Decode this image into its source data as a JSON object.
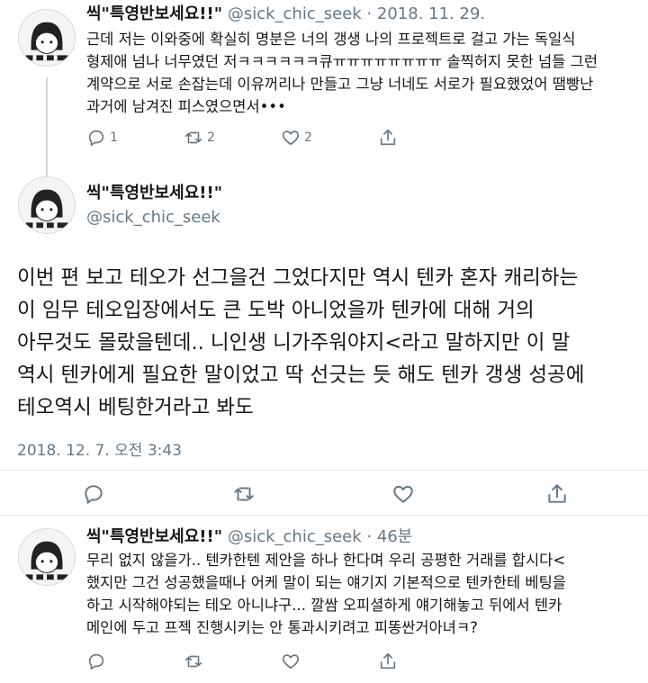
{
  "tweet1": {
    "name": "씩\"특영반보세요!!\"",
    "handle": "@sick_chic_seek",
    "dot": "·",
    "date": "2018. 11. 29.",
    "text": "근데 저는 이와중에 확실히 명분은 너의 갱생 나의 프로젝트로 걸고 가는 독일식\n형제애 넘나 너무였던 저ㅋㅋㅋㅋㅋㅋ큐ㅠㅠㅠㅠㅠㅠㅠㅠ 솔찍허지 못한 넘들 그런\n계약으로 서로 손잡는데 이유꺼리나 만들고 그냥 너네도 서로가 필요했었어 땜빵난\n과거에 남겨진 피스였으면서•••",
    "reply_count": "1",
    "retweet_count": "2",
    "like_count": "2"
  },
  "tweet2": {
    "name": "씩\"특영반보세요!!\"",
    "handle": "@sick_chic_seek",
    "text": "이번 편 보고 테오가 선그을건 그었다지만 역시 텐카 혼자 캐리하는\n이 임무 테오입장에서도 큰 도박 아니었을까 텐카에 대해 거의\n아무것도 몰랐을텐데.. 니인생 니가주워야지<라고 말하지만 이 말\n역시 텐카에게 필요한 말이었고 딱 선긋는 듯 해도 텐카 갱생 성공에\n테오역시 베팅한거라고 봐도",
    "timestamp": "2018. 12. 7. 오전 3:43"
  },
  "tweet3": {
    "name": "씩\"특영반보세요!!\"",
    "handle": "@sick_chic_seek",
    "dot": "·",
    "date": "46분",
    "text": "무리 없지 않을가.. 텐카한텐 제안을 하나 한다며 우리 공평한 거래를 합시다<\n했지만 그건 성공했을때나 어케 말이 되는 얘기지 기본적으로 텐카한테 베팅을\n하고 시작해야되는 테오 아니냐구... 깔쌈 오피셜하게 얘기해놓고 뒤에서 텐카\n메인에 두고 프젝 진행시키는 안 통과시키려고 피똥싼거아녀ㅋ?"
  },
  "icons": [
    "avatar",
    "reply-icon",
    "retweet-icon",
    "like-icon",
    "share-icon"
  ],
  "colors": {
    "text": "#14171a",
    "secondary": "#657786",
    "divider": "#e1e8ed",
    "thread_line": "#cfd9de"
  }
}
